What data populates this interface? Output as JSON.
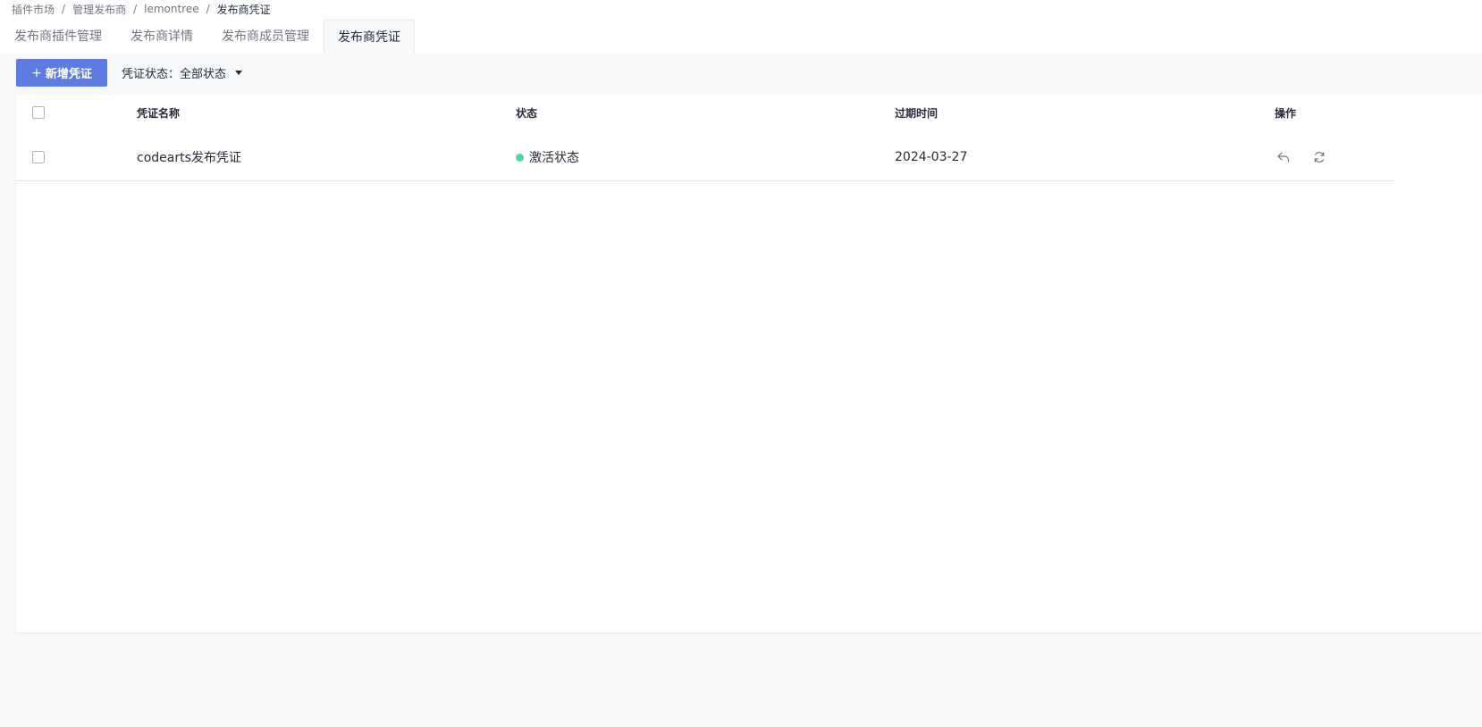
{
  "breadcrumb": {
    "items": [
      "插件市场",
      "管理发布商",
      "lemontree",
      "发布商凭证"
    ],
    "separator": "/"
  },
  "tabs": [
    {
      "label": "发布商插件管理",
      "active": false
    },
    {
      "label": "发布商详情",
      "active": false
    },
    {
      "label": "发布商成员管理",
      "active": false
    },
    {
      "label": "发布商凭证",
      "active": true
    }
  ],
  "toolbar": {
    "add_icon": "+",
    "add_label": "新增凭证",
    "filter_label": "凭证状态：",
    "filter_value": "全部状态"
  },
  "table": {
    "columns": [
      "凭证名称",
      "状态",
      "过期时间",
      "操作"
    ],
    "rows": [
      {
        "name": "codearts发布凭证",
        "status": "激活状态",
        "status_color": "#50d4ab",
        "expire": "2024-03-27",
        "actions": [
          "revoke-icon",
          "refresh-icon"
        ]
      }
    ]
  },
  "colors": {
    "primary": "#5e7ce0",
    "active_status": "#50d4ab",
    "background": "#f7f8fa"
  }
}
